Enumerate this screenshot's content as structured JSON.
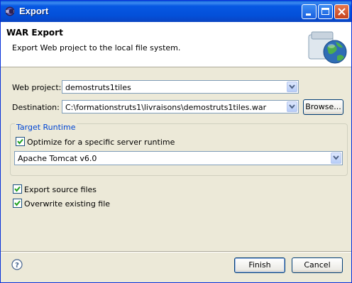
{
  "window": {
    "title": "Export"
  },
  "banner": {
    "title": "WAR Export",
    "description": "Export Web project to the local file system."
  },
  "form": {
    "web_project_label": "Web project:",
    "web_project_value": "demostruts1tiles",
    "destination_label": "Destination:",
    "destination_value": "C:\\formationstruts1\\livraisons\\demostruts1tiles.war",
    "browse_label": "Browse..."
  },
  "target_runtime": {
    "legend": "Target Runtime",
    "optimize_label": "Optimize for a specific server runtime",
    "optimize_checked": true,
    "runtime_value": "Apache Tomcat v6.0"
  },
  "options": {
    "export_source_label": "Export source files",
    "export_source_checked": true,
    "overwrite_label": "Overwrite existing file",
    "overwrite_checked": true
  },
  "footer": {
    "finish_label": "Finish",
    "cancel_label": "Cancel"
  },
  "colors": {
    "titlebar": "#0350d9",
    "dialog_bg": "#ece9d8",
    "group_legend": "#0046d5",
    "check_mark": "#21a121"
  }
}
